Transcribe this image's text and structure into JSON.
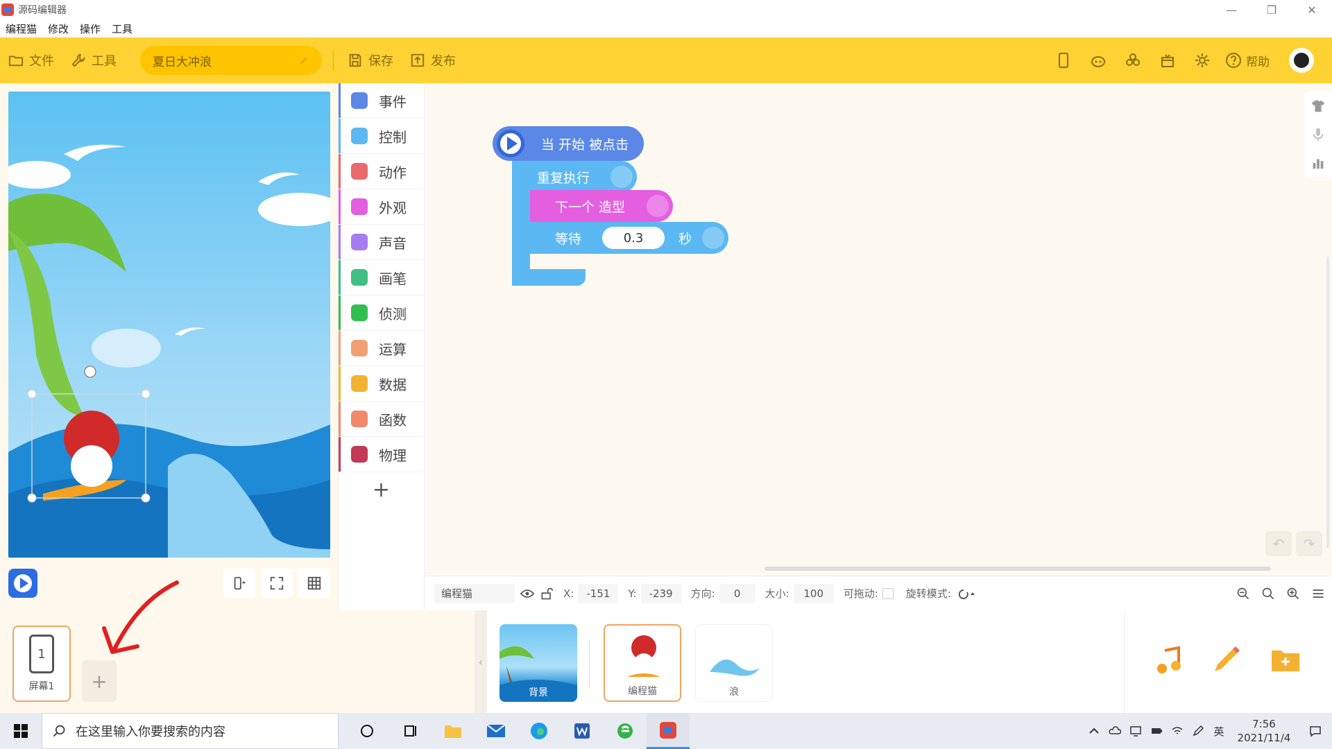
{
  "window": {
    "title": "源码编辑器",
    "minimize": "—",
    "maximize": "❐",
    "close": "✕"
  },
  "menu": {
    "items": [
      "编程猫",
      "修改",
      "操作",
      "工具"
    ]
  },
  "toolbar": {
    "file_label": "文件",
    "tools_label": "工具",
    "project_name": "夏日大冲浪",
    "save_label": "保存",
    "publish_label": "发布",
    "help_label": "帮助"
  },
  "categories": [
    {
      "label": "事件",
      "color": "#5b87e6"
    },
    {
      "label": "控制",
      "color": "#5cb8f2"
    },
    {
      "label": "动作",
      "color": "#e86a6a"
    },
    {
      "label": "外观",
      "color": "#e45ee0"
    },
    {
      "label": "声音",
      "color": "#a67cf0"
    },
    {
      "label": "画笔",
      "color": "#3fbf83"
    },
    {
      "label": "侦测",
      "color": "#2fbf4f"
    },
    {
      "label": "运算",
      "color": "#f2a073"
    },
    {
      "label": "数据",
      "color": "#f2b430"
    },
    {
      "label": "函数",
      "color": "#f08a6a"
    },
    {
      "label": "物理",
      "color": "#c23a55"
    }
  ],
  "blocks": {
    "start": "当 开始 被点击",
    "loop": "重复执行",
    "next_costume": "下一个 造型",
    "wait_label": "等待",
    "wait_value": "0.3",
    "wait_unit": "秒"
  },
  "properties": {
    "sprite_name": "编程猫",
    "x_label": "X:",
    "x_value": "-151",
    "y_label": "Y:",
    "y_value": "-239",
    "direction_label": "方向:",
    "direction_value": "0",
    "size_label": "大小:",
    "size_value": "100",
    "draggable_label": "可拖动:",
    "rotation_label": "旋转模式:"
  },
  "screens": {
    "items": [
      {
        "number": "1",
        "name": "屏幕1"
      }
    ],
    "add": "+"
  },
  "sprites": [
    {
      "name": "背景"
    },
    {
      "name": "编程猫"
    },
    {
      "name": "浪"
    }
  ],
  "taskbar": {
    "search_placeholder": "在这里输入你要搜索的内容",
    "ime": "英",
    "time": "7:56",
    "date": "2021/11/4"
  },
  "colors": {
    "toolbar": "#ffd233",
    "accent_blue": "#2c6de0",
    "selection": "#f0a561"
  }
}
